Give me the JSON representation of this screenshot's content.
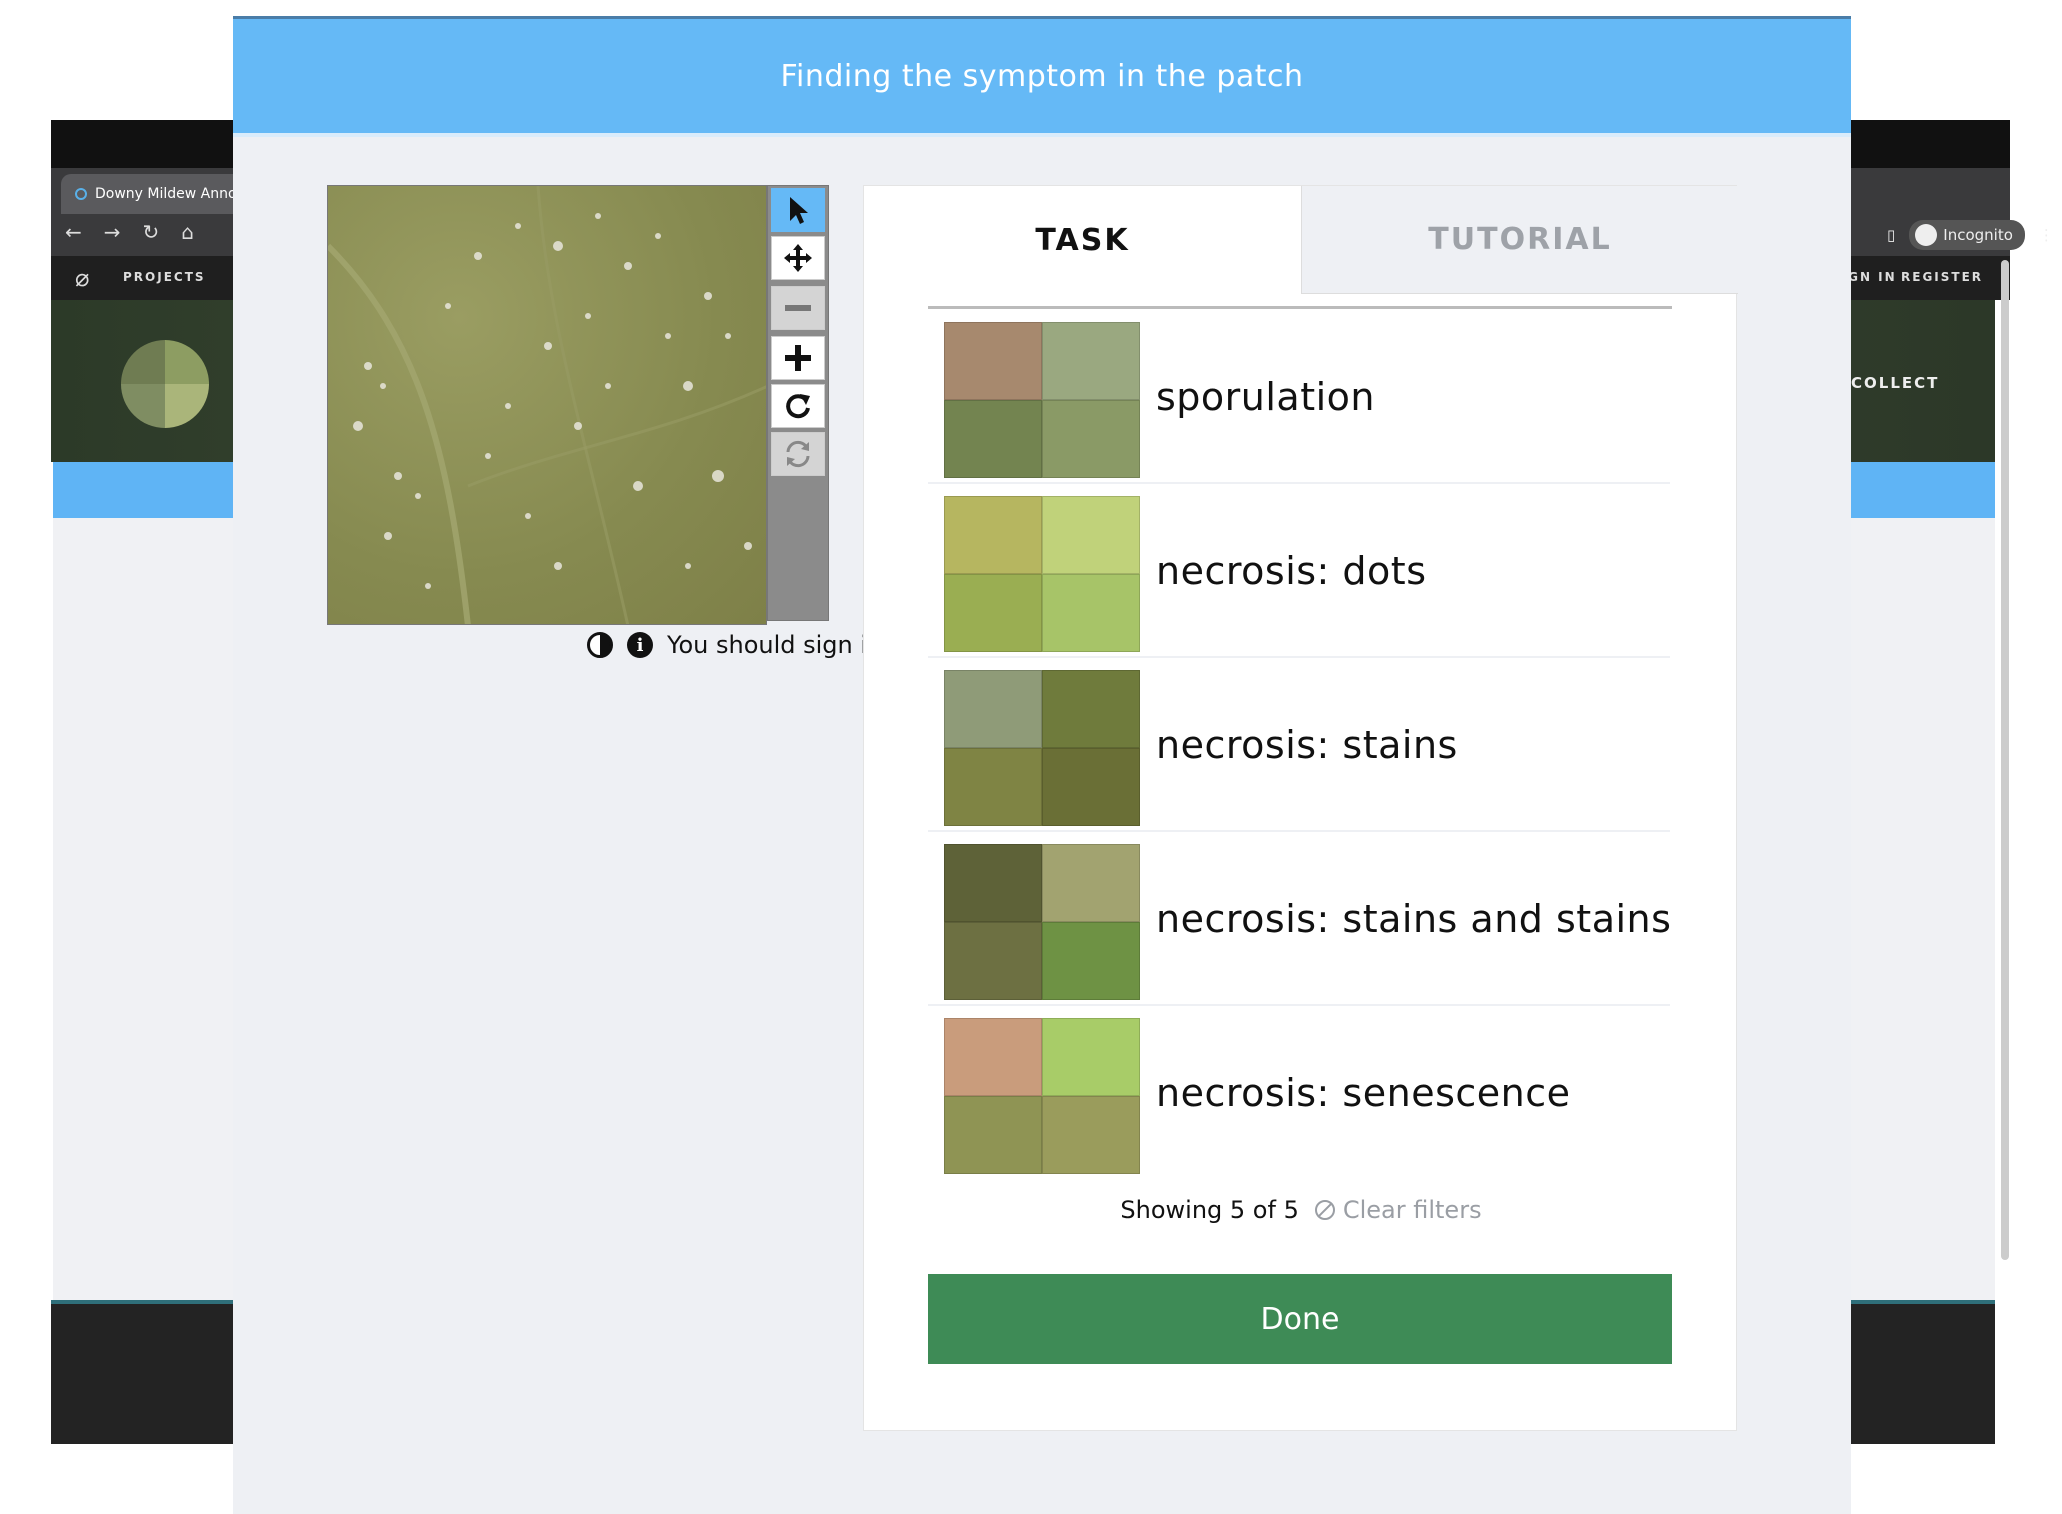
{
  "browser": {
    "tab_title": "Downy Mildew Annota",
    "incognito_label": "Incognito",
    "nav": {
      "projects": "PROJECTS",
      "partial": "A",
      "sign_in": "SIGN IN",
      "register": "REGISTER"
    },
    "hero_button": "COLLECT"
  },
  "modal": {
    "title": "Finding the symptom in the patch",
    "viewer": {
      "tools": [
        "pointer-icon",
        "move-icon",
        "zoom-out-icon",
        "zoom-in-icon",
        "rotate-icon",
        "reset-icon"
      ],
      "active_tool": "pointer",
      "sign_in_message": "You should sign in!"
    },
    "tabs": {
      "task": "TASK",
      "tutorial": "TUTORIAL"
    },
    "choices": [
      {
        "label": "sporulation",
        "colors": [
          "#a7896e",
          "#9aa880",
          "#738450",
          "#8a9a66"
        ]
      },
      {
        "label": "necrosis: dots",
        "colors": [
          "#b6b660",
          "#c0d27a",
          "#9aae52",
          "#a7c468"
        ]
      },
      {
        "label": "necrosis: stains",
        "colors": [
          "#8f9b78",
          "#6f7b3c",
          "#7f8444",
          "#6a6f36"
        ]
      },
      {
        "label": "necrosis: stains and stains",
        "colors": [
          "#5e6238",
          "#a2a370",
          "#6d7042",
          "#6e9244"
        ]
      },
      {
        "label": "necrosis: senescence",
        "colors": [
          "#c99c7c",
          "#a8cc68",
          "#8f9454",
          "#9a9c5c"
        ]
      }
    ],
    "showing": "Showing 5 of 5",
    "clear_filters": "Clear filters",
    "done": "Done",
    "accent": "#65b9f6",
    "done_color": "#3e8b56"
  }
}
